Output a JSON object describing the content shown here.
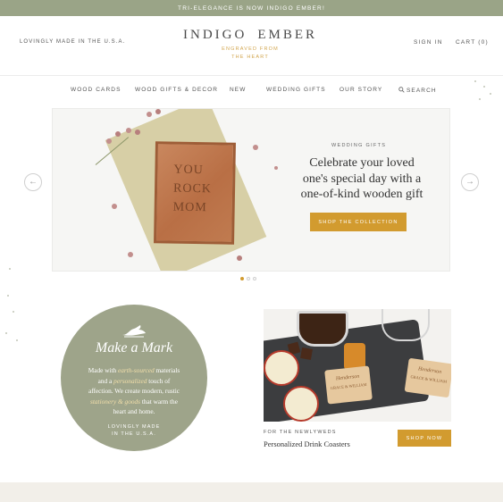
{
  "announcement": "TRI-ELEGANCE IS NOW INDIGO EMBER!",
  "header": {
    "tagline": "LOVINGLY MADE IN THE U.S.A.",
    "logo_left": "INDIGO",
    "logo_right": "EMBER",
    "logo_sub_1": "ENGRAVED FROM",
    "logo_sub_2": "THE HEART",
    "signin": "SIGN IN",
    "cart": "CART (0)"
  },
  "nav": {
    "wood_cards": "WOOD CARDS",
    "wood_gifts": "WOOD GIFTS & DECOR",
    "new": "NEW",
    "wedding_gifts": "WEDDING GIFTS",
    "our_story": "OUR STORY",
    "search": "SEARCH"
  },
  "hero": {
    "card_line_1": "YOU",
    "card_line_2": "ROCK",
    "card_line_3": "MOM",
    "eyebrow": "WEDDING GIFTS",
    "title_1": "Celebrate your loved",
    "title_2": "one's special day with a",
    "title_3": "one-of-kind wooden gift",
    "button": "SHOP THE COLLECTION",
    "slide_index": 1,
    "slide_count": 3
  },
  "badge": {
    "title": "Make a Mark",
    "text_1": "Made with",
    "text_1_em": "earth-sourced",
    "text_1b": "materials",
    "text_2": "and a",
    "text_2_em": "personalized",
    "text_2b": "touch of",
    "text_3": "affection. We create modern, rustic",
    "text_4_em": "stationery & goods",
    "text_4b": "that warm the",
    "text_5": "heart and home.",
    "foot_1": "LOVINGLY MADE",
    "foot_2": "IN THE U.S.A."
  },
  "product": {
    "coaster_1_name": "Henderson",
    "coaster_1_sub": "GRACE & WILLIAM",
    "coaster_2_name": "Henderson",
    "coaster_2_sub": "GRACE & WILLIAM",
    "eyebrow": "FOR THE NEWLYWEDS",
    "title": "Personalized Drink Coasters",
    "button": "SHOP NOW"
  },
  "colors": {
    "accent_gold": "#d29b2f",
    "sage": "#9ea48a"
  }
}
